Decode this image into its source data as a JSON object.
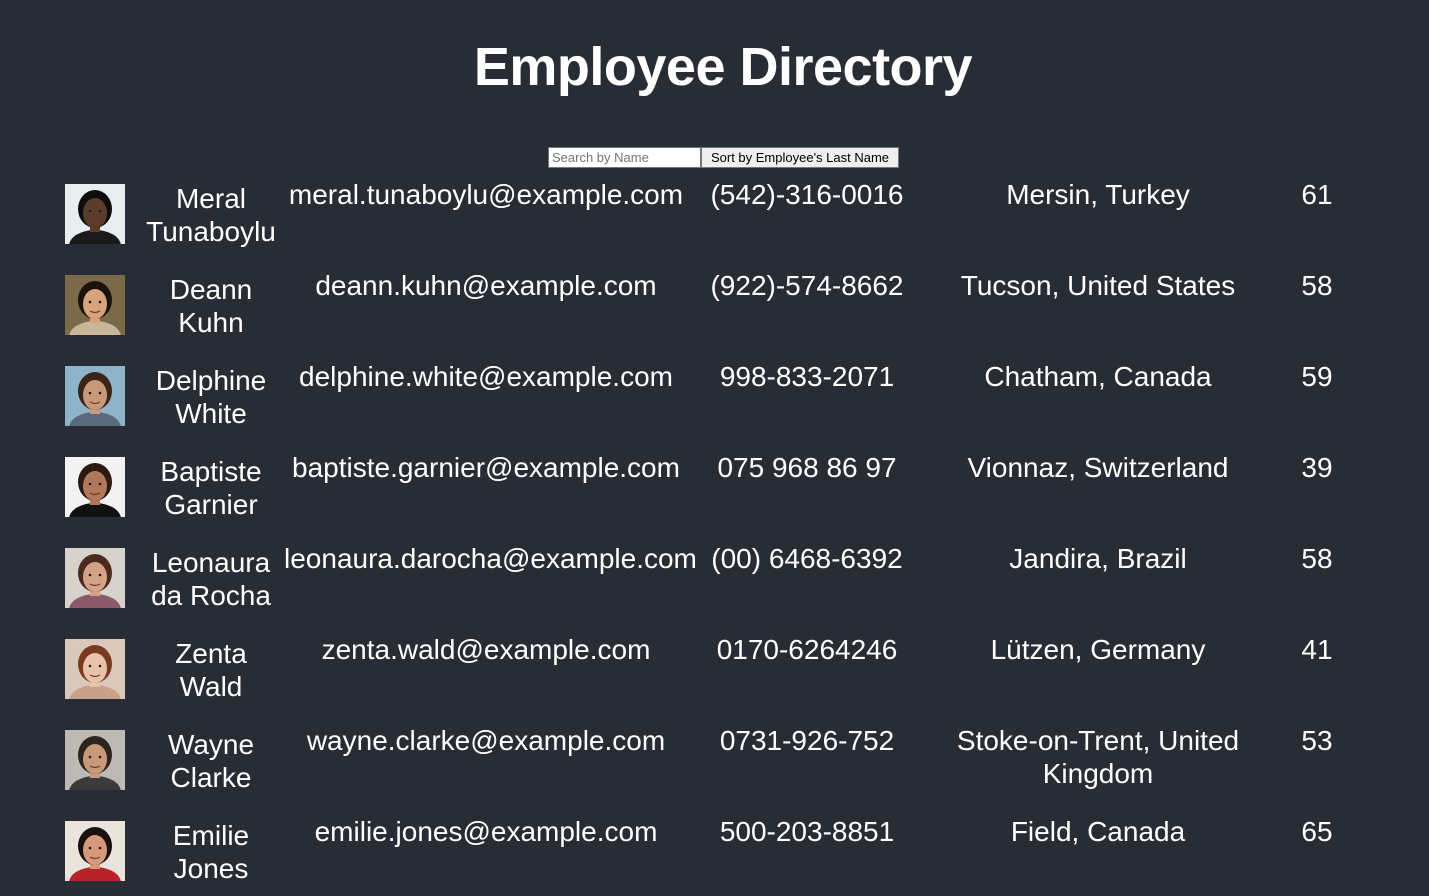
{
  "page": {
    "title": "Employee Directory"
  },
  "controls": {
    "search_placeholder": "Search by Name",
    "sort_label": "Sort by Employee's Last Name"
  },
  "employees": [
    {
      "name": "Meral Tunaboylu",
      "email": "meral.tunaboylu@example.com",
      "phone": "(542)-316-0016",
      "location": "Mersin, Turkey",
      "age": "61",
      "avatar": {
        "bg": "#e6eef0",
        "skin": "#5b3b2a",
        "hair": "#0d0d0d",
        "shirt": "#1a1a1a"
      }
    },
    {
      "name": "Deann Kuhn",
      "email": "deann.kuhn@example.com",
      "phone": "(922)-574-8662",
      "location": "Tucson, United States",
      "age": "58",
      "avatar": {
        "bg": "#7a6a4a",
        "skin": "#d9a37e",
        "hair": "#1c120c",
        "shirt": "#c8b79a"
      }
    },
    {
      "name": "Delphine White",
      "email": "delphine.white@example.com",
      "phone": "998-833-2071",
      "location": "Chatham, Canada",
      "age": "59",
      "avatar": {
        "bg": "#8fb3c9",
        "skin": "#c99a7a",
        "hair": "#3b2418",
        "shirt": "#5a6a7a"
      }
    },
    {
      "name": "Baptiste Garnier",
      "email": "baptiste.garnier@example.com",
      "phone": "075 968 86 97",
      "location": "Vionnaz, Switzerland",
      "age": "39",
      "avatar": {
        "bg": "#f2f2f2",
        "skin": "#b07a5a",
        "hair": "#2a1a12",
        "shirt": "#111111"
      }
    },
    {
      "name": "Leonaura da Rocha",
      "email": "leonaura.darocha@example.com",
      "phone": "(00) 6468-6392",
      "location": "Jandira, Brazil",
      "age": "58",
      "avatar": {
        "bg": "#d8d2cc",
        "skin": "#d4a286",
        "hair": "#4a2a1c",
        "shirt": "#8a5a6a"
      }
    },
    {
      "name": "Zenta Wald",
      "email": "zenta.wald@example.com",
      "phone": "0170-6264246",
      "location": "Lützen, Germany",
      "age": "41",
      "avatar": {
        "bg": "#d9c8bc",
        "skin": "#e8c2aa",
        "hair": "#7a3a22",
        "shirt": "#c9a18a"
      }
    },
    {
      "name": "Wayne Clarke",
      "email": "wayne.clarke@example.com",
      "phone": "0731-926-752",
      "location": "Stoke-on-Trent, United Kingdom",
      "age": "53",
      "avatar": {
        "bg": "#bdbab6",
        "skin": "#c8997a",
        "hair": "#2e241e",
        "shirt": "#3b3b3b"
      }
    },
    {
      "name": "Emilie Jones",
      "email": "emilie.jones@example.com",
      "phone": "500-203-8851",
      "location": "Field, Canada",
      "age": "65",
      "avatar": {
        "bg": "#e9e4dc",
        "skin": "#d69a7a",
        "hair": "#1a1010",
        "shirt": "#b8222a"
      }
    }
  ]
}
